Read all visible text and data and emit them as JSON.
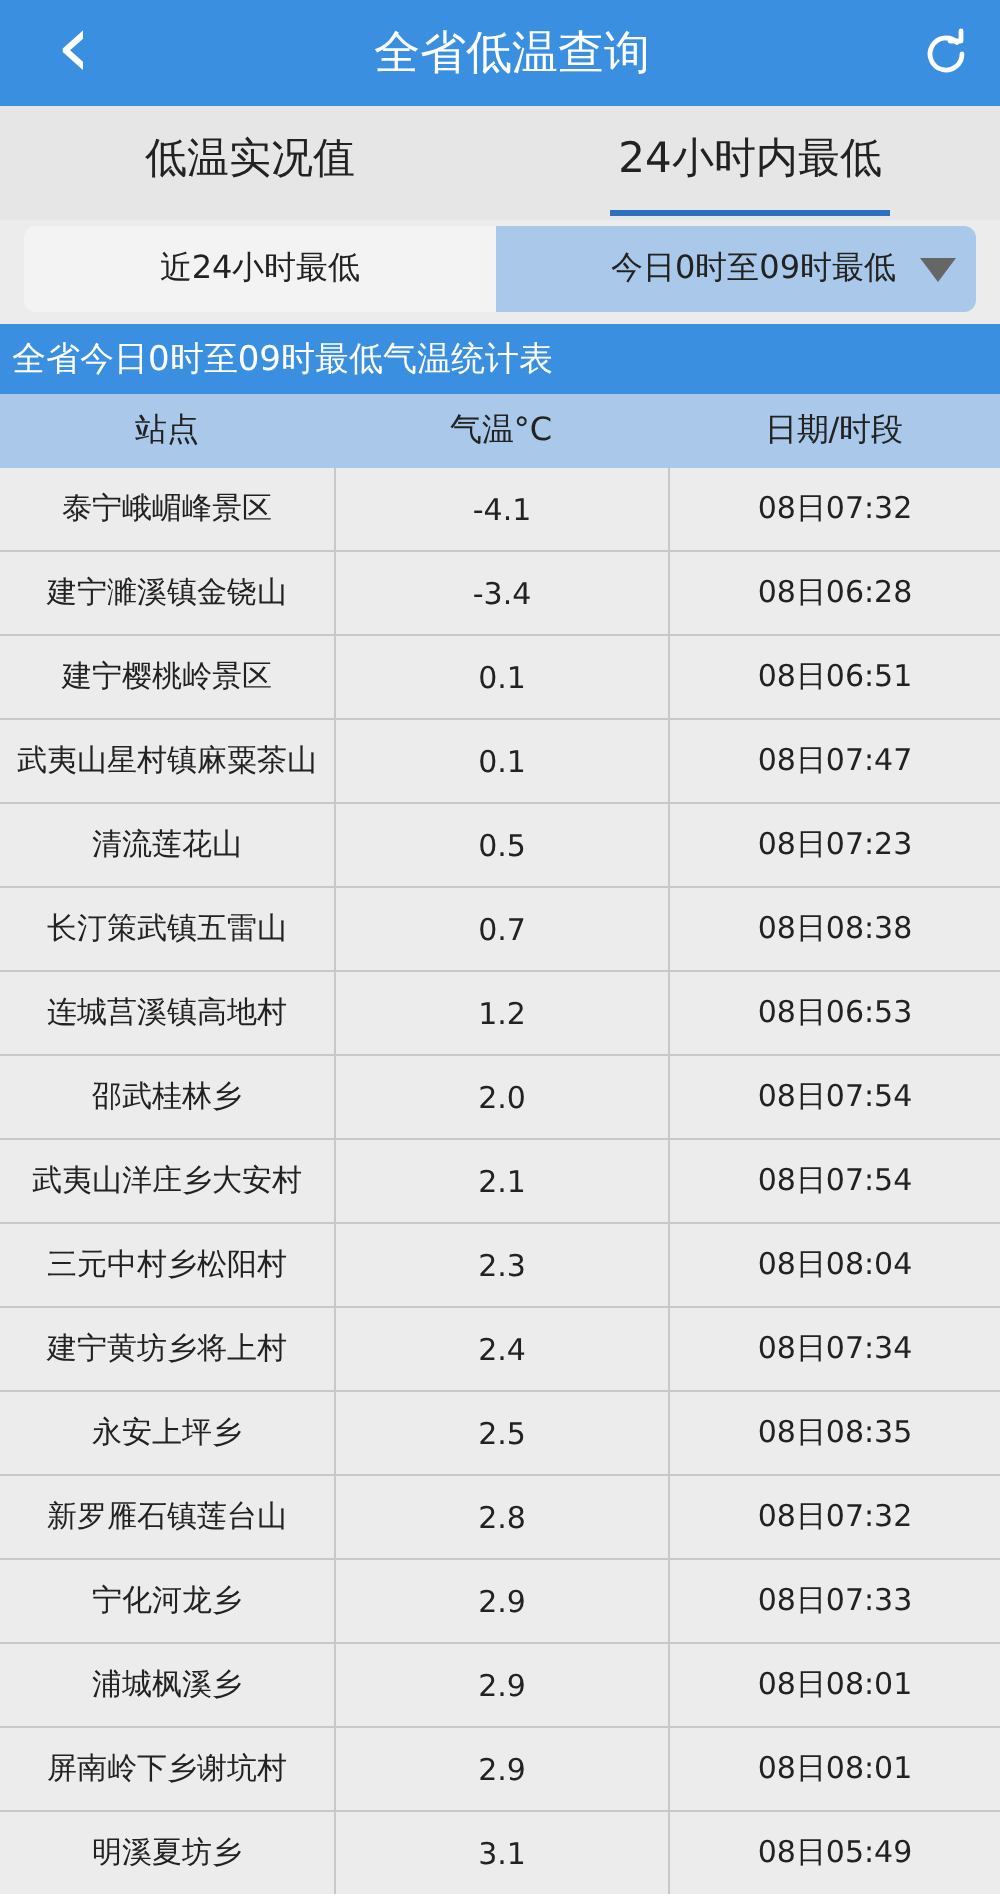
{
  "nav_bar": {
    "back": "‹",
    "title": "全省低温查询"
  },
  "tabs": [
    {
      "label": "低温实况值",
      "selected": false
    },
    {
      "label": "24小时内最低",
      "selected": true
    }
  ],
  "sub_tabs": [
    {
      "label": "近24小时最低",
      "selected": false
    },
    {
      "label": "今日0时至09时最低",
      "selected": true
    }
  ],
  "table": {
    "title": "全省今日0时至09时最低气温统计表",
    "columns": [
      "站点",
      "气温°C",
      "日期/时段"
    ],
    "rows": [
      [
        "泰宁峨嵋峰景区",
        "-4.1",
        "08日07:32"
      ],
      [
        "建宁濉溪镇金铙山",
        "-3.4",
        "08日06:28"
      ],
      [
        "建宁樱桃岭景区",
        "0.1",
        "08日06:51"
      ],
      [
        "武夷山星村镇麻粟茶山",
        "0.1",
        "08日07:47"
      ],
      [
        "清流莲花山",
        "0.5",
        "08日07:23"
      ],
      [
        "长汀策武镇五雷山",
        "0.7",
        "08日08:38"
      ],
      [
        "连城莒溪镇高地村",
        "1.2",
        "08日06:53"
      ],
      [
        "邵武桂林乡",
        "2.0",
        "08日07:54"
      ],
      [
        "武夷山洋庄乡大安村",
        "2.1",
        "08日07:54"
      ],
      [
        "三元中村乡松阳村",
        "2.3",
        "08日08:04"
      ],
      [
        "建宁黄坊乡将上村",
        "2.4",
        "08日07:34"
      ],
      [
        "永安上坪乡",
        "2.5",
        "08日08:35"
      ],
      [
        "新罗雁石镇莲台山",
        "2.8",
        "08日07:32"
      ],
      [
        "宁化河龙乡",
        "2.9",
        "08日07:33"
      ],
      [
        "浦城枫溪乡",
        "2.9",
        "08日08:01"
      ],
      [
        "屏南岭下乡谢坑村",
        "2.9",
        "08日08:01"
      ],
      [
        "明溪夏坊乡",
        "3.1",
        "08日05:49"
      ]
    ]
  }
}
